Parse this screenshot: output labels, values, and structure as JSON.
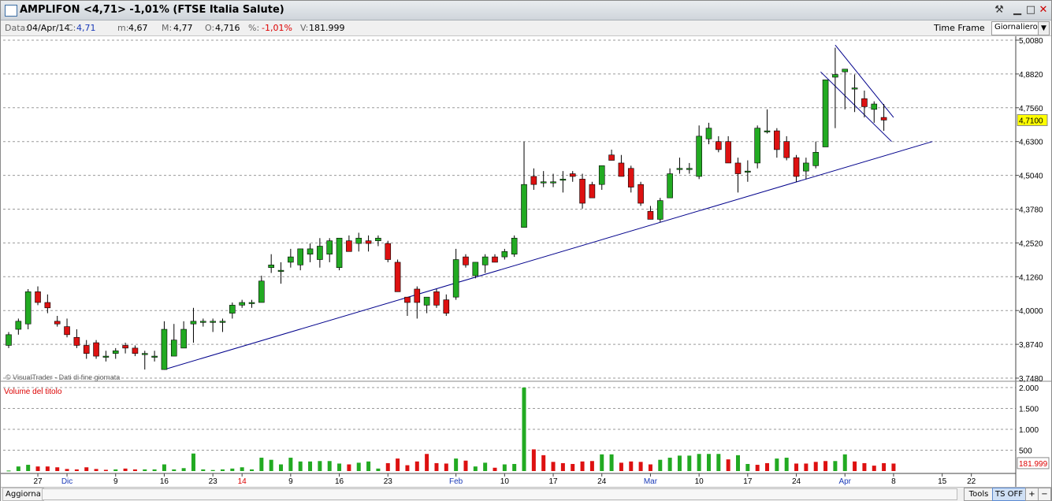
{
  "window": {
    "title": "AMPLIFON <4,71> -1,01%  (FTSE Italia Salute)",
    "buttons": [
      "pin-icon",
      "minimize-icon",
      "maximize-icon",
      "close-icon"
    ]
  },
  "info": {
    "data_label": "Data:",
    "data_value": "04/Apr/14",
    "close_label": "C:",
    "close_value": "4,71",
    "min_label": "m:",
    "min_value": "4,67",
    "max_label": "M:",
    "max_value": "4,77",
    "open_label": "O:",
    "open_value": "4,716",
    "pct_label": "%:",
    "pct_value": "-1,01%",
    "vol_label": "V:",
    "vol_value": "181.999",
    "timeframe_label": "Time Frame",
    "timeframe_value": "Giornaliero"
  },
  "footer": {
    "update_button": "Aggiorna",
    "tools_button": "Tools",
    "ts_button": "TS OFF",
    "plus": "+",
    "minus": "−"
  },
  "colors": {
    "up": "#22aa22",
    "down": "#dd1111",
    "trend": "#00008b",
    "last": "#ffff00"
  },
  "chart_data": {
    "type": "candlestick",
    "watermark": "© VisualTrader - Dati di fine giornata",
    "price_axis": {
      "ticks": [
        "5,0080",
        "4,8820",
        "4,7560",
        "4,6300",
        "4,5040",
        "4,3780",
        "4,2520",
        "4,1260",
        "4,0000",
        "3,8740",
        "3,7480"
      ],
      "ylim": [
        3.748,
        5.008
      ]
    },
    "last_price_label": "4,7100",
    "volume_panel": {
      "title": "Volume del titolo",
      "ticks": [
        "2.000",
        "1.500",
        "1.000",
        "500"
      ],
      "ylim": [
        0,
        2000
      ],
      "last_label": "181.999"
    },
    "x_labels": [
      {
        "i": 3,
        "label": "27",
        "type": "day"
      },
      {
        "i": 6,
        "label": "Dic",
        "type": "month"
      },
      {
        "i": 11,
        "label": "9",
        "type": "day"
      },
      {
        "i": 16,
        "label": "16",
        "type": "day"
      },
      {
        "i": 21,
        "label": "23",
        "type": "day"
      },
      {
        "i": 24,
        "label": "14",
        "type": "year"
      },
      {
        "i": 29,
        "label": "9",
        "type": "day"
      },
      {
        "i": 34,
        "label": "16",
        "type": "day"
      },
      {
        "i": 39,
        "label": "23",
        "type": "day"
      },
      {
        "i": 46,
        "label": "Feb",
        "type": "month"
      },
      {
        "i": 51,
        "label": "10",
        "type": "day"
      },
      {
        "i": 56,
        "label": "17",
        "type": "day"
      },
      {
        "i": 61,
        "label": "24",
        "type": "day"
      },
      {
        "i": 66,
        "label": "Mar",
        "type": "month"
      },
      {
        "i": 71,
        "label": "10",
        "type": "day"
      },
      {
        "i": 76,
        "label": "17",
        "type": "day"
      },
      {
        "i": 81,
        "label": "24",
        "type": "day"
      },
      {
        "i": 86,
        "label": "Apr",
        "type": "month"
      },
      {
        "i": 91,
        "label": "8",
        "type": "day"
      },
      {
        "i": 96,
        "label": "15",
        "type": "day"
      },
      {
        "i": 99,
        "label": "22",
        "type": "day"
      }
    ],
    "candles": [
      [
        3.87,
        3.92,
        3.86,
        3.91
      ],
      [
        3.93,
        3.97,
        3.91,
        3.96
      ],
      [
        3.95,
        4.08,
        3.93,
        4.07
      ],
      [
        4.07,
        4.09,
        4.02,
        4.03
      ],
      [
        4.03,
        4.06,
        3.99,
        4.01
      ],
      [
        3.96,
        3.98,
        3.94,
        3.95
      ],
      [
        3.94,
        3.97,
        3.9,
        3.91
      ],
      [
        3.9,
        3.93,
        3.86,
        3.87
      ],
      [
        3.87,
        3.89,
        3.82,
        3.84
      ],
      [
        3.88,
        3.89,
        3.82,
        3.83
      ],
      [
        3.83,
        3.85,
        3.81,
        3.83
      ],
      [
        3.84,
        3.86,
        3.82,
        3.85
      ],
      [
        3.87,
        3.88,
        3.84,
        3.86
      ],
      [
        3.86,
        3.87,
        3.83,
        3.84
      ],
      [
        3.84,
        3.85,
        3.78,
        3.84
      ],
      [
        3.83,
        3.85,
        3.81,
        3.83
      ],
      [
        3.78,
        3.96,
        3.78,
        3.93
      ],
      [
        3.83,
        3.95,
        3.83,
        3.89
      ],
      [
        3.86,
        3.96,
        3.86,
        3.93
      ],
      [
        3.95,
        4.01,
        3.88,
        3.96
      ],
      [
        3.96,
        3.97,
        3.94,
        3.96
      ],
      [
        3.96,
        3.97,
        3.92,
        3.96
      ],
      [
        3.96,
        3.97,
        3.92,
        3.96
      ],
      [
        3.99,
        4.03,
        3.97,
        4.02
      ],
      [
        4.02,
        4.04,
        4.01,
        4.03
      ],
      [
        4.03,
        4.04,
        4.01,
        4.03
      ],
      [
        4.03,
        4.13,
        4.03,
        4.11
      ],
      [
        4.16,
        4.21,
        4.14,
        4.17
      ],
      [
        4.15,
        4.18,
        4.1,
        4.15
      ],
      [
        4.18,
        4.23,
        4.16,
        4.2
      ],
      [
        4.17,
        4.23,
        4.15,
        4.23
      ],
      [
        4.21,
        4.25,
        4.18,
        4.23
      ],
      [
        4.19,
        4.27,
        4.16,
        4.24
      ],
      [
        4.21,
        4.27,
        4.18,
        4.26
      ],
      [
        4.16,
        4.27,
        4.15,
        4.27
      ],
      [
        4.26,
        4.28,
        4.22,
        4.22
      ],
      [
        4.25,
        4.29,
        4.22,
        4.27
      ],
      [
        4.26,
        4.28,
        4.22,
        4.25
      ],
      [
        4.26,
        4.28,
        4.24,
        4.27
      ],
      [
        4.25,
        4.26,
        4.18,
        4.19
      ],
      [
        4.18,
        4.19,
        4.07,
        4.07
      ],
      [
        4.05,
        4.05,
        3.98,
        4.03
      ],
      [
        4.08,
        4.09,
        3.97,
        4.03
      ],
      [
        4.02,
        4.05,
        3.99,
        4.05
      ],
      [
        4.07,
        4.08,
        4.01,
        4.02
      ],
      [
        4.04,
        4.06,
        3.98,
        3.99
      ],
      [
        4.05,
        4.23,
        4.04,
        4.19
      ],
      [
        4.2,
        4.21,
        4.16,
        4.17
      ],
      [
        4.13,
        4.18,
        4.12,
        4.18
      ],
      [
        4.17,
        4.21,
        4.14,
        4.2
      ],
      [
        4.2,
        4.21,
        4.18,
        4.18
      ],
      [
        4.2,
        4.23,
        4.19,
        4.22
      ],
      [
        4.21,
        4.28,
        4.2,
        4.27
      ],
      [
        4.31,
        4.63,
        4.31,
        4.47
      ],
      [
        4.5,
        4.53,
        4.45,
        4.47
      ],
      [
        4.48,
        4.52,
        4.46,
        4.48
      ],
      [
        4.48,
        4.51,
        4.46,
        4.48
      ],
      [
        4.49,
        4.52,
        4.44,
        4.49
      ],
      [
        4.51,
        4.52,
        4.48,
        4.5
      ],
      [
        4.49,
        4.51,
        4.38,
        4.4
      ],
      [
        4.47,
        4.48,
        4.42,
        4.42
      ],
      [
        4.47,
        4.54,
        4.45,
        4.54
      ],
      [
        4.58,
        4.6,
        4.56,
        4.56
      ],
      [
        4.55,
        4.58,
        4.5,
        4.5
      ],
      [
        4.53,
        4.54,
        4.44,
        4.46
      ],
      [
        4.47,
        4.48,
        4.39,
        4.4
      ],
      [
        4.37,
        4.39,
        4.34,
        4.34
      ],
      [
        4.34,
        4.42,
        4.33,
        4.41
      ],
      [
        4.42,
        4.53,
        4.42,
        4.51
      ],
      [
        4.53,
        4.57,
        4.51,
        4.53
      ],
      [
        4.53,
        4.55,
        4.51,
        4.53
      ],
      [
        4.5,
        4.69,
        4.49,
        4.65
      ],
      [
        4.64,
        4.7,
        4.62,
        4.68
      ],
      [
        4.63,
        4.65,
        4.59,
        4.6
      ],
      [
        4.63,
        4.65,
        4.55,
        4.55
      ],
      [
        4.55,
        4.57,
        4.44,
        4.51
      ],
      [
        4.52,
        4.56,
        4.48,
        4.52
      ],
      [
        4.55,
        4.69,
        4.53,
        4.68
      ],
      [
        4.67,
        4.75,
        4.66,
        4.67
      ],
      [
        4.67,
        4.68,
        4.57,
        4.6
      ],
      [
        4.63,
        4.65,
        4.56,
        4.57
      ],
      [
        4.57,
        4.58,
        4.48,
        4.5
      ],
      [
        4.52,
        4.57,
        4.49,
        4.55
      ],
      [
        4.54,
        4.63,
        4.53,
        4.59
      ],
      [
        4.61,
        4.86,
        4.61,
        4.86
      ],
      [
        4.87,
        4.98,
        4.68,
        4.88
      ],
      [
        4.89,
        4.9,
        4.75,
        4.9
      ],
      [
        4.83,
        4.88,
        4.74,
        4.83
      ],
      [
        4.79,
        4.82,
        4.72,
        4.76
      ],
      [
        4.75,
        4.78,
        4.7,
        4.77
      ],
      [
        4.72,
        4.77,
        4.67,
        4.71
      ]
    ],
    "volume": [
      [
        12,
        "up"
      ],
      [
        110,
        "up"
      ],
      [
        150,
        "up"
      ],
      [
        110,
        "down"
      ],
      [
        110,
        "down"
      ],
      [
        90,
        "down"
      ],
      [
        50,
        "down"
      ],
      [
        40,
        "down"
      ],
      [
        90,
        "down"
      ],
      [
        50,
        "down"
      ],
      [
        30,
        "down"
      ],
      [
        40,
        "up"
      ],
      [
        60,
        "down"
      ],
      [
        40,
        "down"
      ],
      [
        40,
        "up"
      ],
      [
        40,
        "up"
      ],
      [
        160,
        "up"
      ],
      [
        40,
        "up"
      ],
      [
        70,
        "up"
      ],
      [
        420,
        "up"
      ],
      [
        40,
        "up"
      ],
      [
        25,
        "up"
      ],
      [
        40,
        "up"
      ],
      [
        60,
        "up"
      ],
      [
        90,
        "up"
      ],
      [
        40,
        "up"
      ],
      [
        320,
        "up"
      ],
      [
        270,
        "up"
      ],
      [
        160,
        "up"
      ],
      [
        320,
        "up"
      ],
      [
        230,
        "up"
      ],
      [
        230,
        "up"
      ],
      [
        240,
        "up"
      ],
      [
        240,
        "up"
      ],
      [
        180,
        "up"
      ],
      [
        160,
        "down"
      ],
      [
        200,
        "up"
      ],
      [
        230,
        "up"
      ],
      [
        60,
        "up"
      ],
      [
        190,
        "down"
      ],
      [
        300,
        "down"
      ],
      [
        140,
        "down"
      ],
      [
        230,
        "down"
      ],
      [
        410,
        "down"
      ],
      [
        190,
        "down"
      ],
      [
        180,
        "down"
      ],
      [
        300,
        "up"
      ],
      [
        250,
        "down"
      ],
      [
        110,
        "up"
      ],
      [
        200,
        "up"
      ],
      [
        80,
        "down"
      ],
      [
        160,
        "up"
      ],
      [
        170,
        "up"
      ],
      [
        2000,
        "up"
      ],
      [
        520,
        "down"
      ],
      [
        380,
        "down"
      ],
      [
        220,
        "down"
      ],
      [
        190,
        "down"
      ],
      [
        170,
        "down"
      ],
      [
        230,
        "down"
      ],
      [
        240,
        "down"
      ],
      [
        400,
        "up"
      ],
      [
        400,
        "up"
      ],
      [
        200,
        "down"
      ],
      [
        230,
        "down"
      ],
      [
        220,
        "down"
      ],
      [
        160,
        "down"
      ],
      [
        270,
        "up"
      ],
      [
        320,
        "up"
      ],
      [
        370,
        "up"
      ],
      [
        370,
        "up"
      ],
      [
        410,
        "up"
      ],
      [
        410,
        "up"
      ],
      [
        410,
        "up"
      ],
      [
        280,
        "down"
      ],
      [
        380,
        "up"
      ],
      [
        170,
        "up"
      ],
      [
        150,
        "down"
      ],
      [
        190,
        "down"
      ],
      [
        300,
        "up"
      ],
      [
        320,
        "up"
      ],
      [
        180,
        "down"
      ],
      [
        180,
        "down"
      ],
      [
        220,
        "down"
      ],
      [
        240,
        "down"
      ],
      [
        240,
        "up"
      ],
      [
        400,
        "up"
      ],
      [
        230,
        "down"
      ],
      [
        190,
        "down"
      ],
      [
        130,
        "down"
      ],
      [
        190,
        "down"
      ],
      [
        180,
        "down"
      ]
    ]
  }
}
